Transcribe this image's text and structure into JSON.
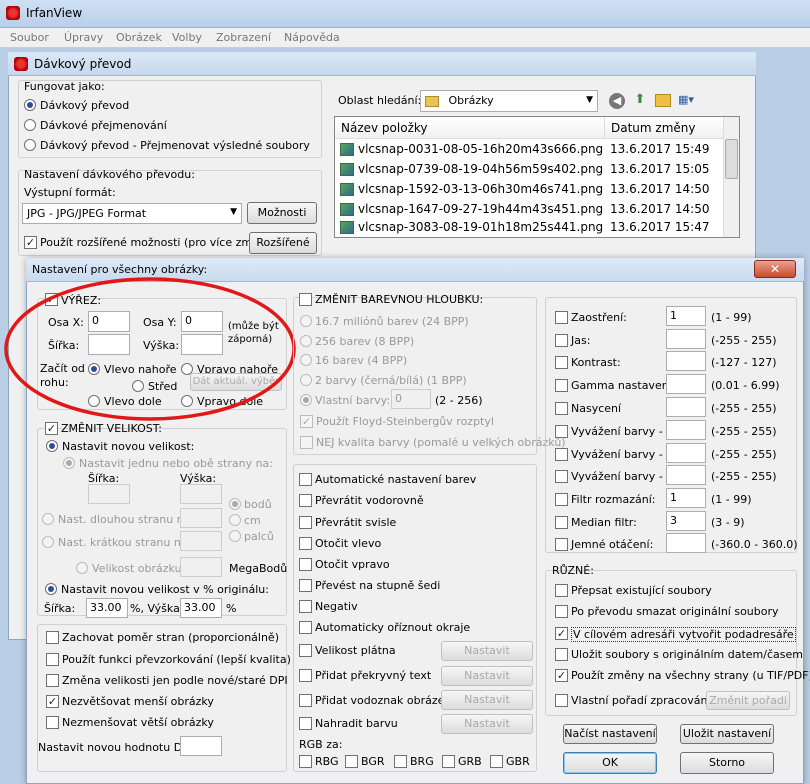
{
  "app": {
    "title": "IrfanView"
  },
  "menu": [
    "Soubor",
    "Úpravy",
    "Obrázek",
    "Volby",
    "Zobrazení",
    "Nápověda"
  ],
  "batch": {
    "title": "Dávkový převod",
    "work_as": {
      "label": "Fungovat jako:",
      "options": [
        "Dávkový převod",
        "Dávkové přejmenování",
        "Dávkový převod - Přejmenovat výsledné soubory"
      ],
      "selected": 0
    },
    "settings_label": "Nastavení dávkového převodu:",
    "output_format_label": "Výstupní formát:",
    "output_format_value": "JPG - JPG/JPEG Format",
    "options_button": "Možnosti",
    "advanced_checkbox": "Použít rozšířené možnosti (pro více změn)",
    "advanced_button": "Rozšířené",
    "search_label": "Oblast hledání:",
    "search_value": "Obrázky",
    "columns": [
      "Název položky",
      "Datum změny"
    ],
    "files": [
      {
        "name": "vlcsnap-0031-08-05-16h20m43s666.png",
        "date": "13.6.2017 15:49"
      },
      {
        "name": "vlcsnap-0739-08-19-04h56m59s402.png",
        "date": "13.6.2017 15:05"
      },
      {
        "name": "vlcsnap-1592-03-13-06h30m46s741.png",
        "date": "13.6.2017 14:50"
      },
      {
        "name": "vlcsnap-1647-09-27-19h44m43s451.png",
        "date": "13.6.2017 14:50"
      },
      {
        "name": "vlcsnap-3083-08-19-01h18m25s441.png",
        "date": "13.6.2017 15:47"
      }
    ]
  },
  "dialog": {
    "title": "Nastavení pro všechny obrázky:",
    "crop": {
      "label": "VÝŘEZ:",
      "checked": true,
      "x_label": "Osa X:",
      "x_value": "0",
      "y_label": "Osa Y:",
      "y_value": "0",
      "neg_note": "(může být\nzáporná)",
      "w_label": "Šířka:",
      "h_label": "Výška:",
      "start_label": "Začít od\nrohu:",
      "corners": [
        "Vlevo nahoře",
        "Vpravo nahoře",
        "Střed",
        "Vlevo dole",
        "Vpravo dole"
      ],
      "corner_selected": 0,
      "current_sel_button": "Dát aktuál. výběr"
    },
    "resize": {
      "label": "ZMĚNIT VELIKOST:",
      "set_new": "Nastavit novou velikost:",
      "one_or_both": "Nastavit jednu nebo obě strany na:",
      "w": "Šířka:",
      "h": "Výška:",
      "units": [
        "bodů",
        "cm",
        "palců"
      ],
      "long_side": "Nast. dlouhou stranu na:",
      "short_side": "Nast. krátkou stranu na:",
      "image_size": "Velikost obrázku na:",
      "megapixels": "MegaBodů",
      "percent": "Nastavit novou velikost v % originálu:",
      "pct_w_label": "Šířka:",
      "pct_w": "33.00",
      "pct_h_label": "%, Výška:",
      "pct_h": "33.00",
      "pct_unit": "%"
    },
    "left_checks": [
      {
        "label": "Zachovat poměr stran (proporcionálně)",
        "checked": false
      },
      {
        "label": "Použít funkci převzorkování (lepší kvalita)",
        "checked": false
      },
      {
        "label": "Změna velikosti jen podle nové/staré DPI",
        "checked": false
      },
      {
        "label": "Nezvětšovat menší obrázky",
        "checked": true
      },
      {
        "label": "Nezmenšovat větší obrázky",
        "checked": false
      }
    ],
    "dpi_label": "Nastavit novou hodnotu DPI:",
    "color_depth": {
      "label": "ZMĚNIT BAREVNOU HLOUBKU:",
      "options": [
        "16.7 miliónů barev (24 BPP)",
        "256 barev (8 BPP)",
        "16 barev (4 BPP)",
        "2 barvy (černá/bílá) (1 BPP)",
        "Vlastní barvy:"
      ],
      "custom_value": "0",
      "custom_range": "(2 - 256)",
      "floyd": "Použít Floyd-Steinbergův rozptyl",
      "nej": "NEJ kvalita barvy (pomalé u velkých obrázků)"
    },
    "middle_checks": [
      "Automatické nastavení barev",
      "Převrátit vodorovně",
      "Převrátit svisle",
      "Otočit vlevo",
      "Otočit vpravo",
      "Převést na stupně šedi",
      "Negativ",
      "Automaticky oříznout okraje"
    ],
    "set_checks": [
      "Velikost plátna",
      "Přidat překryvný text",
      "Přidat vodoznak obrázek",
      "Nahradit barvu"
    ],
    "set_button": "Nastavit",
    "rgb_label": "RGB za:",
    "rgb": [
      "RBG",
      "BGR",
      "BRG",
      "GRB",
      "GBR"
    ],
    "adjust": [
      {
        "label": "Zaostření:",
        "value": "1",
        "range": "(1 - 99)"
      },
      {
        "label": "Jas:",
        "value": "",
        "range": "(-255 - 255)"
      },
      {
        "label": "Kontrast:",
        "value": "",
        "range": "(-127 - 127)"
      },
      {
        "label": "Gamma nastavení:",
        "value": "",
        "range": "(0.01 - 6.99)"
      },
      {
        "label": "Nasycení",
        "value": "",
        "range": "(-255 - 255)"
      },
      {
        "label": "Vyvážení barvy - Č:",
        "value": "",
        "range": "(-255 - 255)"
      },
      {
        "label": "Vyvážení barvy - Z:",
        "value": "",
        "range": "(-255 - 255)"
      },
      {
        "label": "Vyvážení barvy - M:",
        "value": "",
        "range": "(-255 - 255)"
      },
      {
        "label": "Filtr rozmazání:",
        "value": "1",
        "range": "(1 - 99)"
      },
      {
        "label": "Median filtr:",
        "value": "3",
        "range": "(3 - 9)"
      },
      {
        "label": "Jemné otáčení:",
        "value": "",
        "range": "(-360.0 - 360.0)"
      }
    ],
    "misc_label": "RŮZNÉ:",
    "misc": [
      {
        "label": "Přepsat existující soubory",
        "checked": false
      },
      {
        "label": "Po převodu smazat originální soubory",
        "checked": false
      },
      {
        "label": "V cílovém adresáři vytvořit podadresáře",
        "checked": true
      },
      {
        "label": "Uložit soubory s originálním datem/časem",
        "checked": false
      },
      {
        "label": "Použít změny na všechny strany (u TIF/PDF)",
        "checked": true
      },
      {
        "label": "Vlastní pořadí zpracování",
        "checked": false
      }
    ],
    "change_order_button": "Změnit pořadí",
    "load_button": "Načíst nastavení",
    "save_button": "Uložit nastavení",
    "ok_button": "OK",
    "cancel_button": "Storno"
  }
}
